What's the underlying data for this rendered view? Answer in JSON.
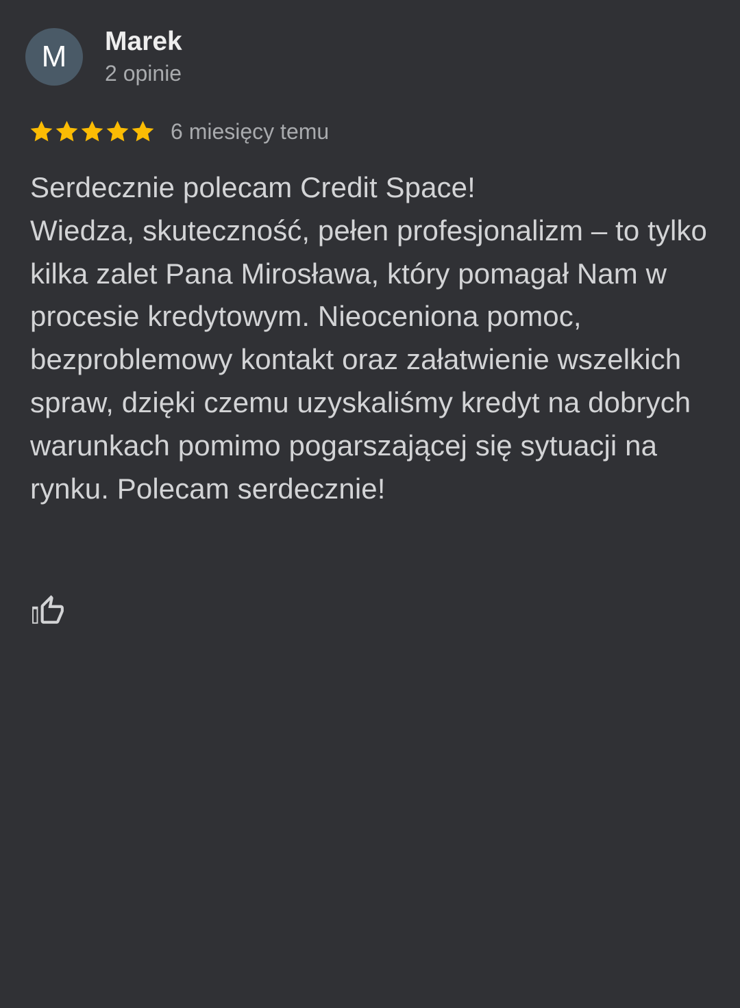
{
  "author": {
    "avatar_letter": "M",
    "name": "Marek",
    "reviews_count": "2 opinie",
    "avatar_color": "#4a5a67"
  },
  "rating": {
    "stars": 5,
    "max_stars": 5,
    "star_color": "#fbbc04",
    "timestamp": "6 miesięcy temu"
  },
  "review": {
    "text": "Serdecznie polecam Credit Space!\nWiedza, skuteczność, pełen profesjonalizm – to tylko kilka zalet Pana Mirosława, który pomagał Nam w procesie kredytowym. Nieoceniona pomoc, bezproblemowy kontakt oraz załatwienie wszelkich spraw, dzięki czemu uzyskaliśmy kredyt na dobrych warunkach pomimo pogarszającej się sytuacji na rynku. Polecam serdecznie!"
  },
  "actions": {
    "like_icon": "thumbs-up-outline-icon"
  },
  "theme": {
    "background": "#303135",
    "text_primary": "#eeeeee",
    "text_secondary": "#a9abae",
    "text_body": "#d3d4d6"
  }
}
